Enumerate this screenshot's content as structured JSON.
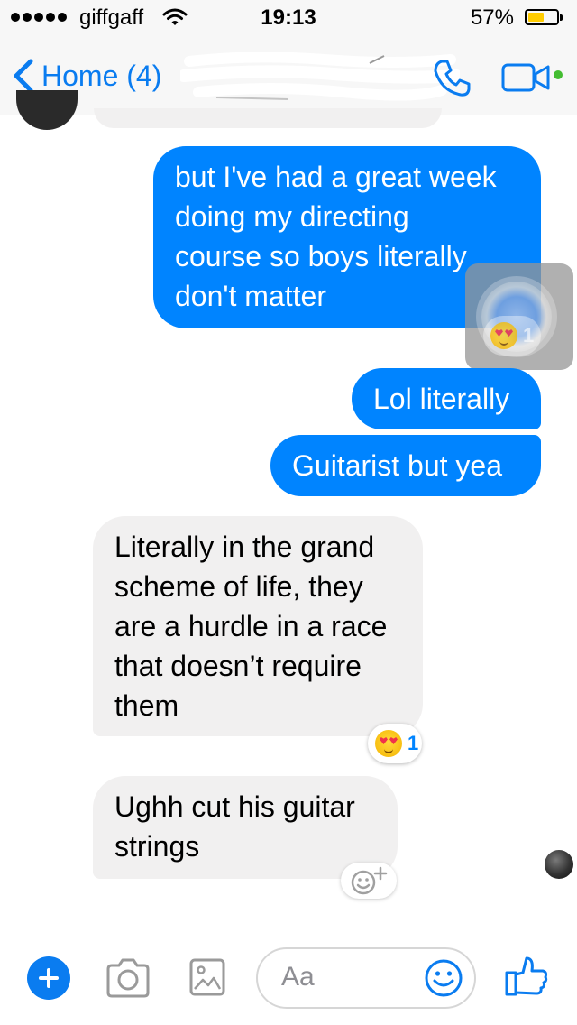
{
  "status_bar": {
    "carrier": "giffgaff",
    "time": "19:13",
    "battery_percent": "57%",
    "battery_level": 0.57
  },
  "nav": {
    "back_label": "Home (4)",
    "title_redacted": true,
    "icons": [
      "chevron-left-icon",
      "phone-icon",
      "video-camera-icon"
    ],
    "accent_color": "#0a7cf0",
    "active_status_color": "#44bd32"
  },
  "messages": [
    {
      "id": "m1",
      "direction": "outgoing",
      "lines": [
        "but I've had a great week",
        "doing my directing",
        "course so boys literally",
        "don't matter"
      ],
      "reaction": {
        "emoji": "heart-eyes-emoji",
        "count": "1"
      }
    },
    {
      "id": "m2",
      "direction": "outgoing",
      "lines": [
        "Lol literally"
      ]
    },
    {
      "id": "m3",
      "direction": "outgoing",
      "lines": [
        "Guitarist but yea"
      ]
    },
    {
      "id": "m4",
      "direction": "incoming",
      "lines": [
        "Literally in the grand",
        "scheme of life, they",
        "are a hurdle in a race",
        "that doesn’t require",
        "them"
      ],
      "reaction": {
        "emoji": "heart-eyes-emoji",
        "count": "1"
      }
    },
    {
      "id": "m5",
      "direction": "incoming",
      "lines": [
        "Ughh cut his guitar",
        "strings"
      ]
    }
  ],
  "bubble_colors": {
    "outgoing": "#0084ff",
    "incoming": "#f1f0f0"
  },
  "composer": {
    "placeholder": "Aa",
    "icons": [
      "plus-icon",
      "camera-icon",
      "image-icon",
      "smiley-icon",
      "thumbs-up-icon"
    ]
  }
}
